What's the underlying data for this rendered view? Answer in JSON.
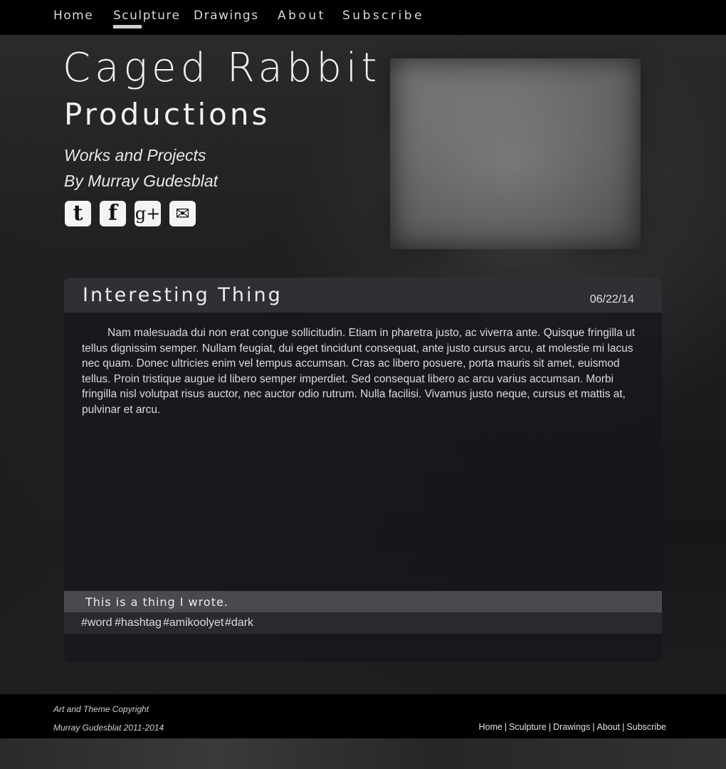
{
  "nav": {
    "items": [
      {
        "label": "Home"
      },
      {
        "label": "Sculpture",
        "active": true
      },
      {
        "label": "Drawings"
      },
      {
        "label": "About"
      },
      {
        "label": "Subscribe"
      }
    ]
  },
  "header": {
    "title": "Caged Rabbit",
    "subtitle": "Productions",
    "tagline1": "Works and Projects",
    "tagline2": "By Murray Gudesblat"
  },
  "social": [
    {
      "icon": "tumblr-icon",
      "glyph": "t"
    },
    {
      "icon": "facebook-icon",
      "glyph": "f"
    },
    {
      "icon": "google-plus-icon",
      "glyph": "g+"
    },
    {
      "icon": "email-icon",
      "glyph": "✉"
    }
  ],
  "post": {
    "title": "Interesting Thing",
    "date": "06/22/14",
    "body": "Nam malesuada dui non erat congue sollicitudin. Etiam in pharetra justo, ac viverra ante. Quisque fringilla ut tellus dignissim semper. Nullam feugiat, dui eget tincidunt consequat, ante justo cursus arcu, at molestie mi lacus nec quam. Donec ultricies enim vel tempus accumsan. Cras ac libero posuere, porta mauris sit amet, euismod tellus. Proin tristique augue id libero semper imperdiet. Sed consequat libero ac arcu varius accumsan. Morbi fringilla nisl volutpat risus auctor, nec auctor odio rutrum. Nulla facilisi. Vivamus justo neque, cursus et mattis at, pulvinar et arcu.",
    "caption": "This is a thing I wrote.",
    "tags": [
      "#word",
      "#hashtag",
      "#amikoolyet",
      "#dark"
    ]
  },
  "footer": {
    "copyright_line1": "Art and Theme Copyright",
    "copyright_line2": "Murray Gudesblat 2011-2014",
    "links": [
      "Home",
      "Sculpture",
      "Drawings",
      "About",
      "Subscribe"
    ],
    "separator": "|"
  },
  "colors": {
    "nav_bg": "#000000",
    "post_header_bg": "#2f3034",
    "caption_bg": "#4a4a4e",
    "text": "#e6e6e6"
  }
}
